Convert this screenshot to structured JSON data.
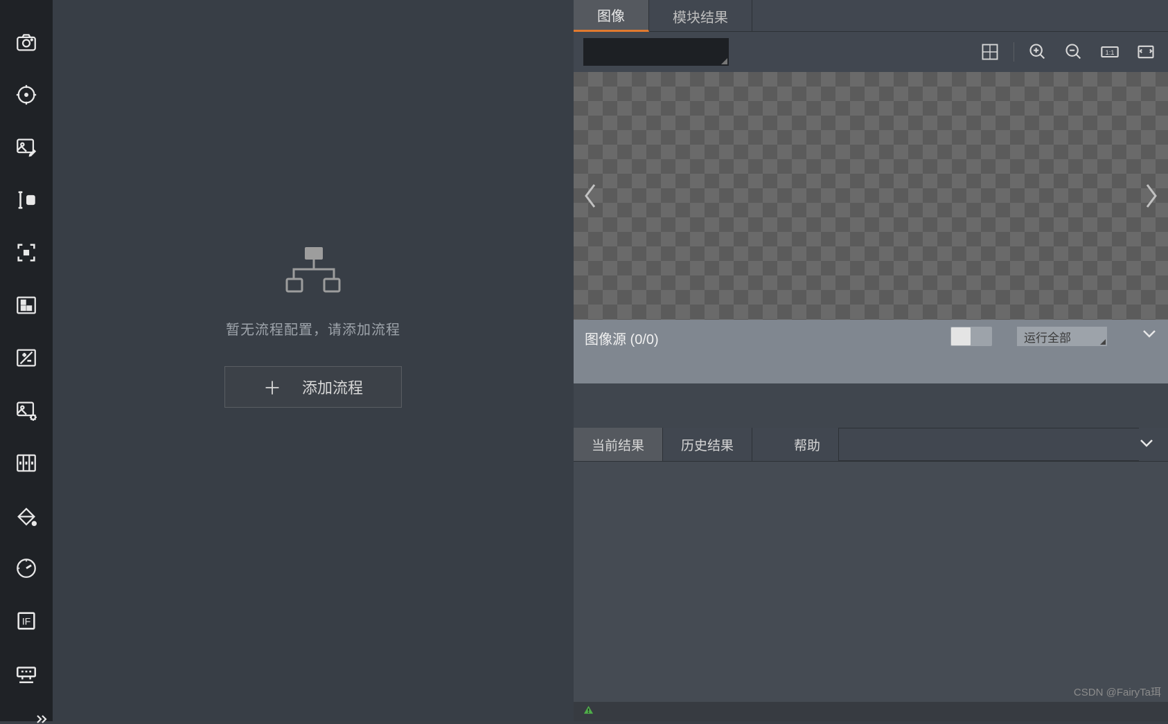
{
  "toolbar": {
    "items": [
      {
        "name": "camera-icon"
      },
      {
        "name": "target-icon"
      },
      {
        "name": "image-edit-icon"
      },
      {
        "name": "text-cursor-icon"
      },
      {
        "name": "focus-square-icon"
      },
      {
        "name": "hierarchy-icon"
      },
      {
        "name": "plus-minus-icon"
      },
      {
        "name": "image-settings-icon"
      },
      {
        "name": "columns-icon"
      },
      {
        "name": "paint-bucket-icon"
      },
      {
        "name": "gauge-icon"
      },
      {
        "name": "if-block-icon"
      },
      {
        "name": "io-icon"
      }
    ]
  },
  "flow": {
    "empty_message": "暂无流程配置，请添加流程",
    "add_button": "添加流程"
  },
  "right": {
    "tabs": [
      {
        "label": "图像",
        "active": true
      },
      {
        "label": "模块结果",
        "active": false
      }
    ],
    "image_source": "图像源 (0/0)",
    "run_select": "运行全部",
    "lower_tabs": [
      {
        "label": "当前结果",
        "active": true
      },
      {
        "label": "历史结果",
        "active": false
      },
      {
        "label": "帮助",
        "active": false
      }
    ]
  },
  "watermark": "CSDN @FairyTa珥"
}
